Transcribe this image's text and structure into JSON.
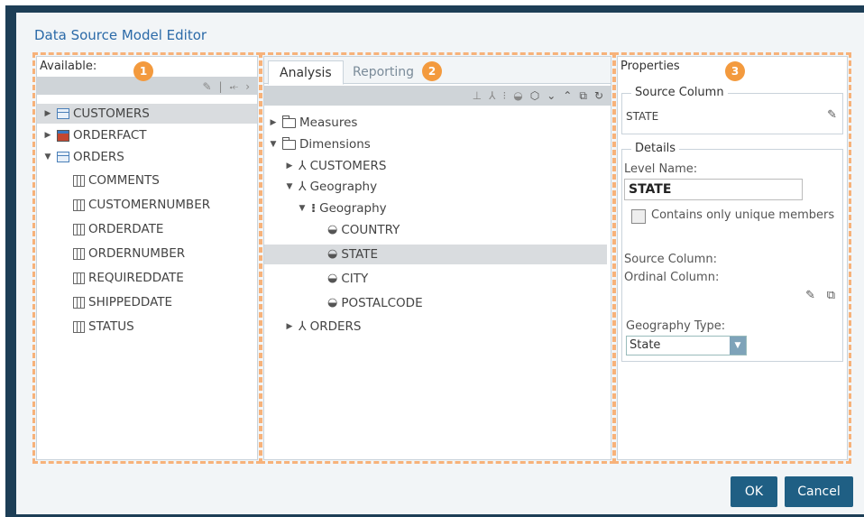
{
  "dialog": {
    "title": "Data Source Model Editor"
  },
  "badges": [
    "1",
    "2",
    "3"
  ],
  "available": {
    "label": "Available:",
    "toolbar_icons": [
      "pencil-icon",
      "separator",
      "split-icon",
      "chevron-right-icon"
    ],
    "tree": [
      {
        "label": "CUSTOMERS",
        "icon": "table-icon",
        "expanded": false,
        "selected": true
      },
      {
        "label": "ORDERFACT",
        "icon": "fact-table-icon",
        "expanded": false
      },
      {
        "label": "ORDERS",
        "icon": "table-icon",
        "expanded": true
      },
      {
        "label": "COMMENTS",
        "icon": "column-icon"
      },
      {
        "label": "CUSTOMERNUMBER",
        "icon": "column-icon"
      },
      {
        "label": "ORDERDATE",
        "icon": "column-icon"
      },
      {
        "label": "ORDERNUMBER",
        "icon": "column-icon"
      },
      {
        "label": "REQUIREDDATE",
        "icon": "column-icon"
      },
      {
        "label": "SHIPPEDDATE",
        "icon": "column-icon"
      },
      {
        "label": "STATUS",
        "icon": "column-icon"
      }
    ]
  },
  "model": {
    "tabs": [
      {
        "label": "Analysis",
        "active": true
      },
      {
        "label": "Reporting",
        "active": false
      }
    ],
    "toolbar_icons": [
      "measure-icon",
      "dimension-icon",
      "hierarchy-icon",
      "level-icon",
      "tag-icon",
      "chevron-down-icon",
      "chevron-up-icon",
      "edit-icon",
      "refresh-icon"
    ],
    "tree": [
      {
        "label": "Measures",
        "icon": "folder-icon",
        "expanded": false
      },
      {
        "label": "Dimensions",
        "icon": "folder-icon",
        "expanded": true
      },
      {
        "label": "CUSTOMERS",
        "icon": "dimension-icon",
        "expanded": false
      },
      {
        "label": "Geography",
        "icon": "dimension-icon",
        "expanded": true
      },
      {
        "label": "Geography",
        "icon": "hierarchy-icon",
        "expanded": true
      },
      {
        "label": "COUNTRY",
        "icon": "level-icon"
      },
      {
        "label": "STATE",
        "icon": "level-icon",
        "selected": true
      },
      {
        "label": "CITY",
        "icon": "level-icon"
      },
      {
        "label": "POSTALCODE",
        "icon": "level-icon"
      },
      {
        "label": "ORDERS",
        "icon": "dimension-icon",
        "expanded": false
      }
    ]
  },
  "properties": {
    "label": "Properties",
    "source_column": {
      "legend": "Source Column",
      "value": "STATE"
    },
    "details": {
      "legend": "Details",
      "level_name_label": "Level Name:",
      "level_name_value": "STATE",
      "unique_label": "Contains only unique members",
      "source_column_label": "Source Column:",
      "ordinal_column_label": "Ordinal Column:",
      "geography_type_label": "Geography Type:",
      "geography_type_value": "State"
    }
  },
  "buttons": {
    "ok": "OK",
    "cancel": "Cancel"
  },
  "colors": {
    "accent": "#f39a3e",
    "button": "#1f5f84",
    "title": "#2b6aa8"
  }
}
